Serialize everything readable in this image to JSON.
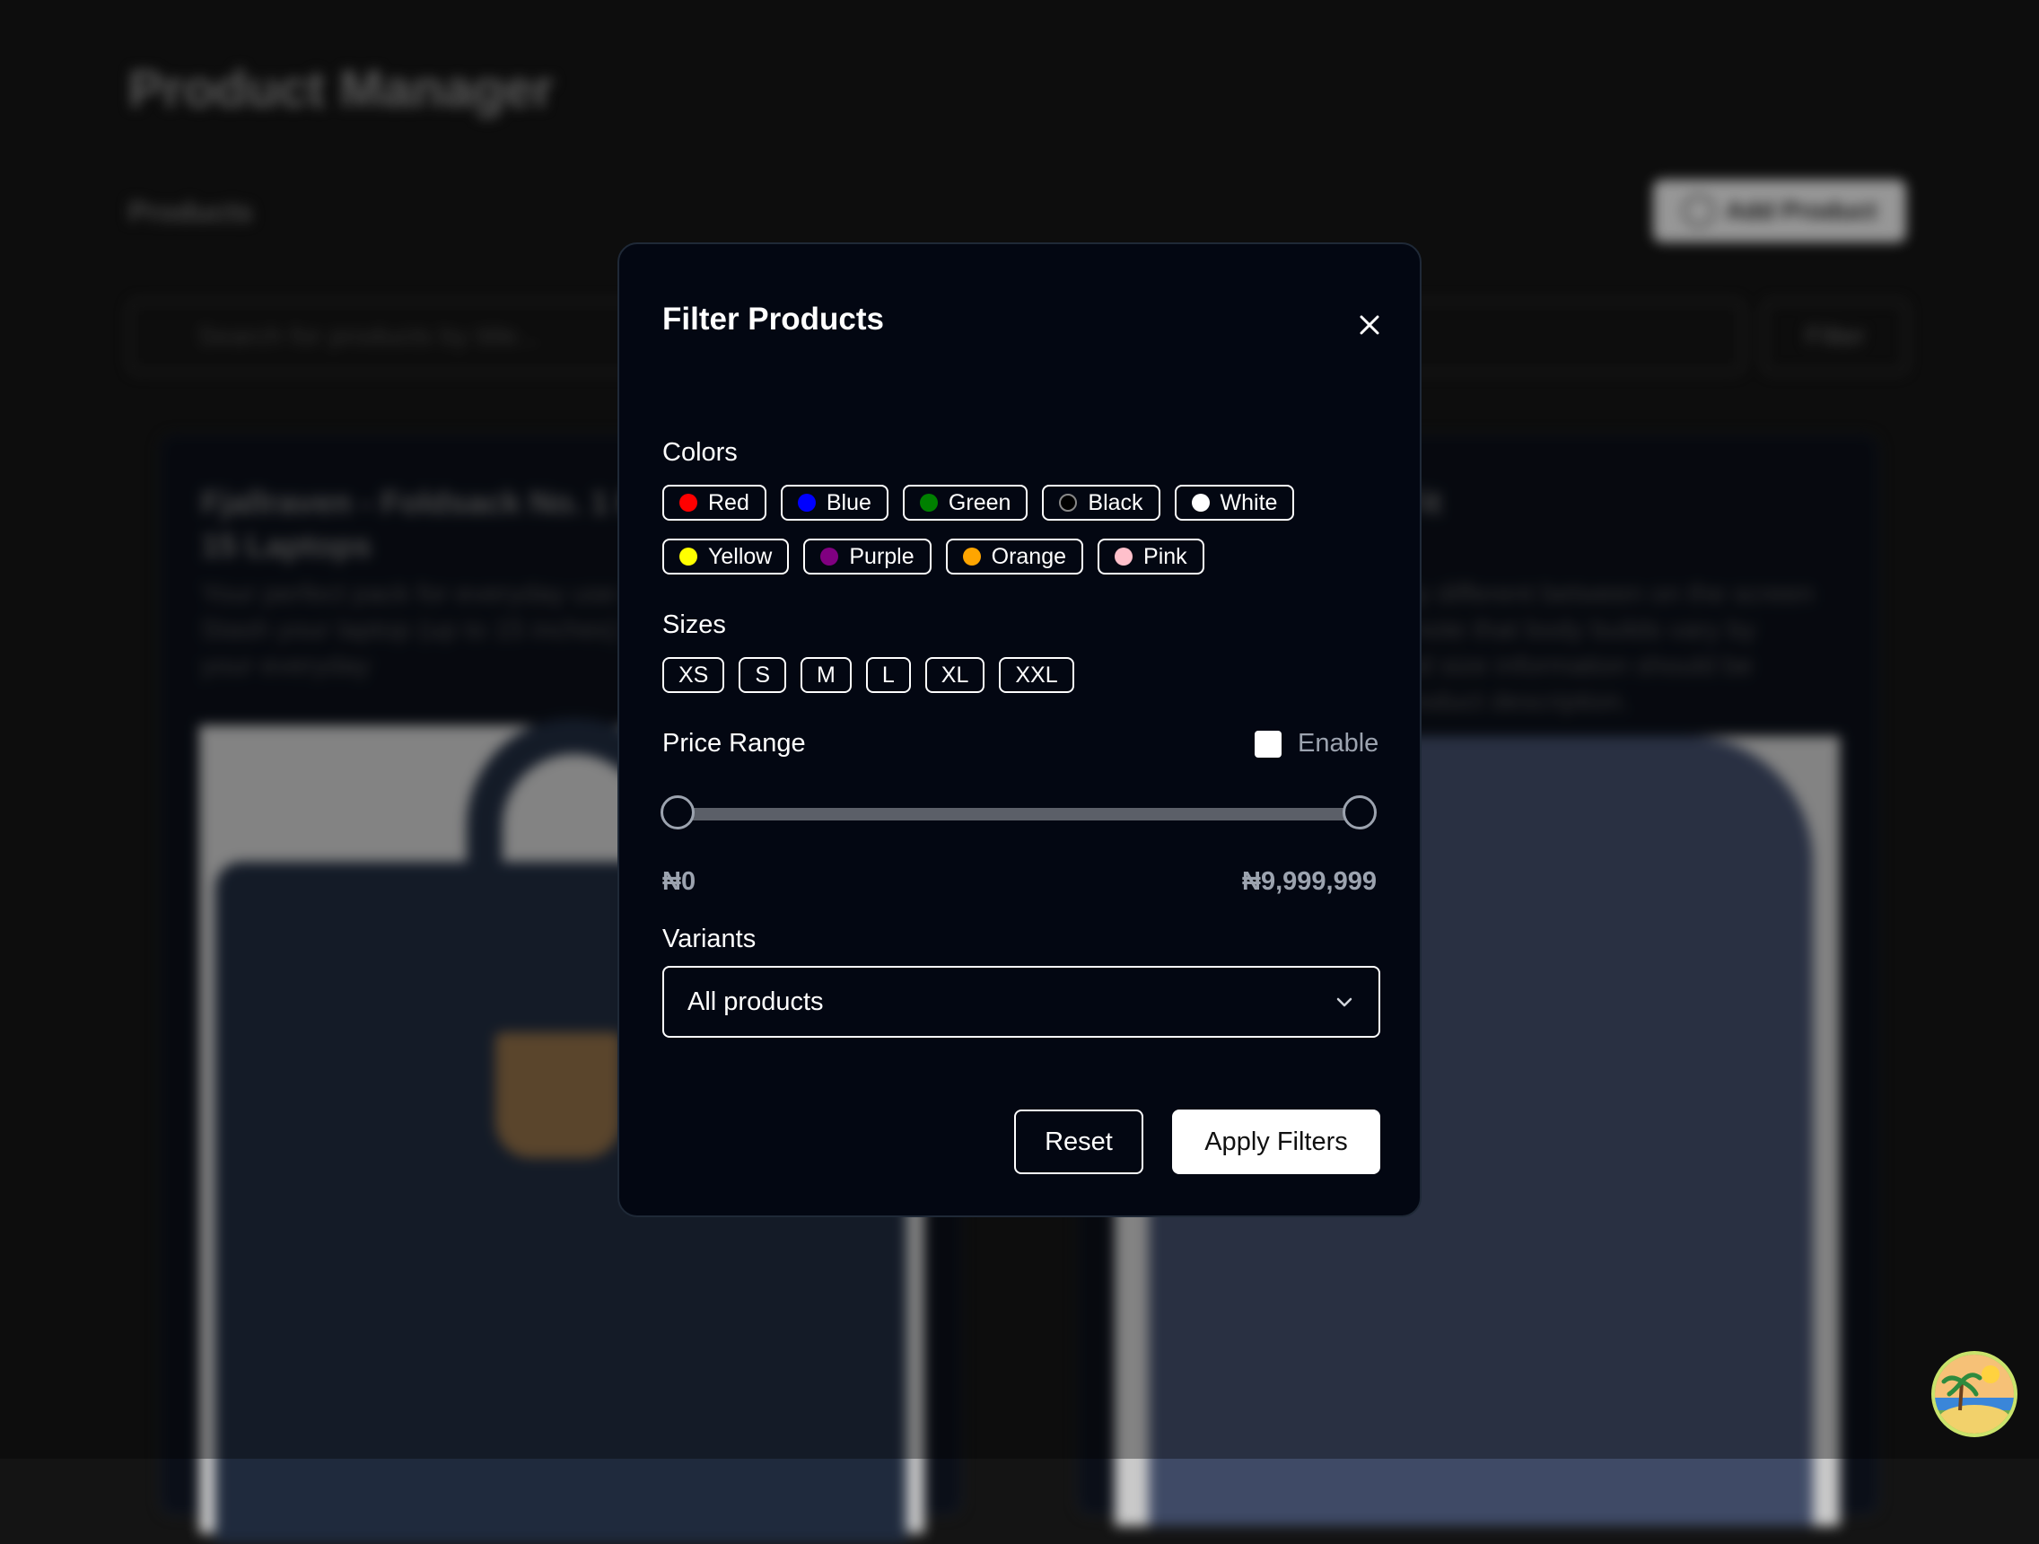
{
  "background": {
    "title": "Product Manager",
    "section": "Products",
    "add_button": "Add Product",
    "search_placeholder": "Search for products by title...",
    "filter_button": "Filter",
    "cards": [
      {
        "title": "Fjallraven - Foldsack No. 1 Backpack, Fits 15 Laptops",
        "description": "Your perfect pack for everyday use and walks in the forest. Stash your laptop (up to 15 inches) in the padded sleeve, your everyday"
      },
      {
        "title": "Mens Casual Slim Fit",
        "description": "The color could be slightly different between on the screen and in practice. / Please note that body builds vary by person, therefore, detailed size information should be reviewed below on the product description."
      }
    ]
  },
  "modal": {
    "title": "Filter Products",
    "colors_label": "Colors",
    "colors": [
      {
        "label": "Red",
        "color": "#ff0000"
      },
      {
        "label": "Blue",
        "color": "#0000ff"
      },
      {
        "label": "Green",
        "color": "#008000"
      },
      {
        "label": "Black",
        "color": "#000000"
      },
      {
        "label": "White",
        "color": "#ffffff"
      },
      {
        "label": "Yellow",
        "color": "#ffff00"
      },
      {
        "label": "Purple",
        "color": "#800080"
      },
      {
        "label": "Orange",
        "color": "#ffa500"
      },
      {
        "label": "Pink",
        "color": "#ffc0cb"
      }
    ],
    "sizes_label": "Sizes",
    "sizes": [
      "XS",
      "S",
      "M",
      "L",
      "XL",
      "XXL"
    ],
    "price_label": "Price Range",
    "enable_label": "Enable",
    "price_min": "₦0",
    "price_max": "₦9,999,999",
    "variants_label": "Variants",
    "variants_selected": "All products",
    "reset_label": "Reset",
    "apply_label": "Apply Filters"
  },
  "icons": {
    "close": "close-icon",
    "chevron": "chevron-down-icon",
    "badge": "beach-avatar-icon"
  }
}
